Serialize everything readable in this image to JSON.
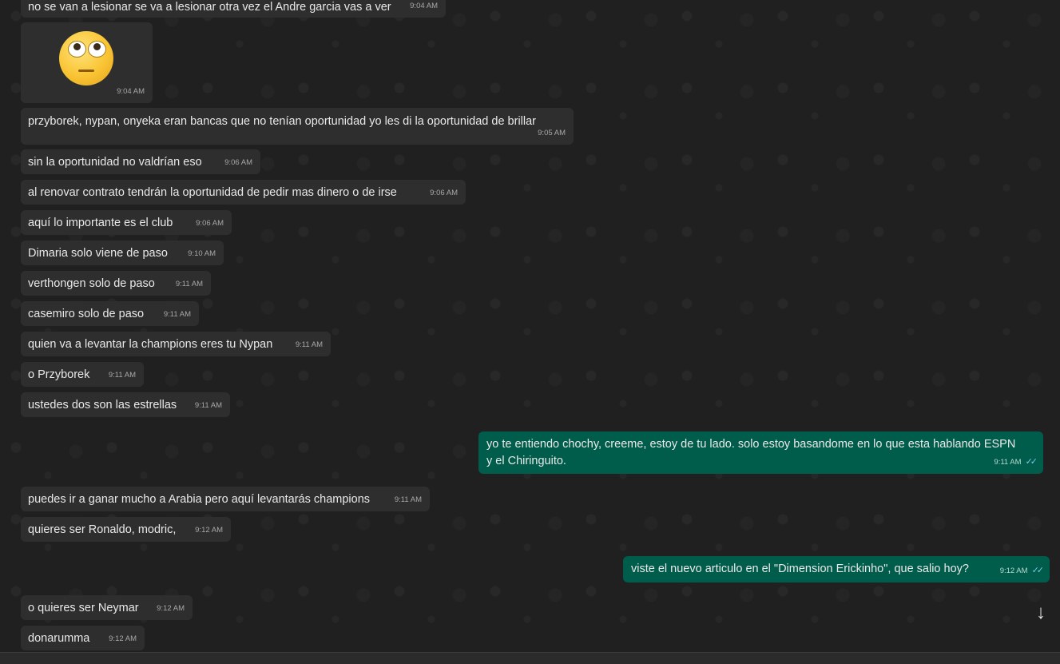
{
  "messages": [
    {
      "text": "no se van a lesionar se va a lesionar otra vez el Andre garcia vas a ver",
      "time": "9:04 AM"
    },
    {
      "time": "9:04 AM"
    },
    {
      "text": "przyborek, nypan, onyeka eran bancas que no tenían oportunidad yo les di la oportunidad de brillar",
      "time": "9:05 AM"
    },
    {
      "text": "sin la oportunidad no valdrían eso",
      "time": "9:06 AM"
    },
    {
      "text": "al renovar contrato tendrán la oportunidad de pedir mas dinero o de irse",
      "time": "9:06 AM"
    },
    {
      "text": "aquí lo importante es el club",
      "time": "9:06 AM"
    },
    {
      "text": "Dimaria solo viene de paso",
      "time": "9:10 AM"
    },
    {
      "text": "verthongen solo de paso",
      "time": "9:11 AM"
    },
    {
      "text": "casemiro solo de paso",
      "time": "9:11 AM"
    },
    {
      "text": "quien va a levantar la champions eres tu Nypan",
      "time": "9:11 AM"
    },
    {
      "text": "o Przyborek",
      "time": "9:11 AM"
    },
    {
      "text": "ustedes dos son las estrellas",
      "time": "9:11 AM"
    },
    {
      "text_line1": "yo te entiendo chochy, creeme, estoy de tu lado. solo estoy basandome en lo que esta hablando ESPN",
      "text_line2": "y el Chiringuito.",
      "time": "9:11 AM"
    },
    {
      "text": "puedes ir a ganar mucho a Arabia pero aquí levantarás champions",
      "time": "9:11 AM"
    },
    {
      "text": "quieres ser Ronaldo, modric,",
      "time": "9:12 AM"
    },
    {
      "text": "viste el nuevo articulo en el \"Dimension Erickinho\", que salio hoy?",
      "time": "9:12 AM"
    },
    {
      "text": "o quieres ser Neymar",
      "time": "9:12 AM"
    },
    {
      "text": "donarumma",
      "time": "9:12 AM"
    }
  ],
  "icons": {
    "sticker": "face-with-rolling-eyes-emoji",
    "read_receipt": "double-check-icon",
    "scroll_down": "arrow-down-icon"
  },
  "colors": {
    "incoming_bubble": "#2e2e2e",
    "outgoing_bubble": "#005c4b",
    "read_receipt": "#7fc8e6"
  }
}
